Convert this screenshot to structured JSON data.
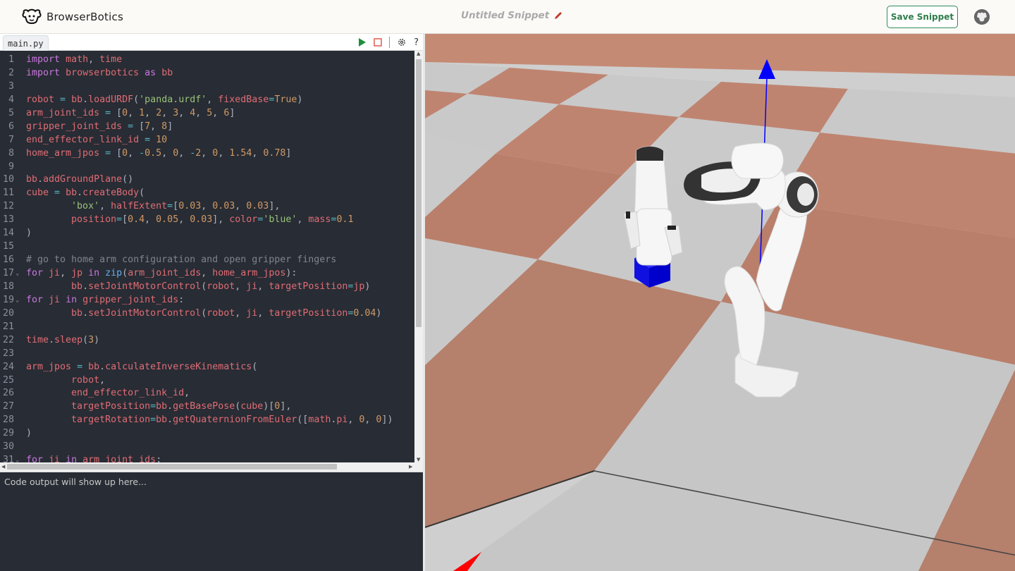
{
  "app": {
    "brand_name": "BrowserBotics",
    "snippet_title": "Untitled Snippet",
    "save_label": "Save Snippet"
  },
  "editor": {
    "file_tab": "main.py",
    "tools": {
      "run_icon": "play-icon",
      "stop_icon": "stop-icon",
      "settings_icon": "gear-icon",
      "help_label": "?"
    },
    "lines": [
      {
        "n": "1"
      },
      {
        "n": "2"
      },
      {
        "n": "3"
      },
      {
        "n": "4"
      },
      {
        "n": "5"
      },
      {
        "n": "6"
      },
      {
        "n": "7"
      },
      {
        "n": "8"
      },
      {
        "n": "9"
      },
      {
        "n": "10"
      },
      {
        "n": "11"
      },
      {
        "n": "12"
      },
      {
        "n": "13"
      },
      {
        "n": "14"
      },
      {
        "n": "15"
      },
      {
        "n": "16"
      },
      {
        "n": "17"
      },
      {
        "n": "18"
      },
      {
        "n": "19"
      },
      {
        "n": "20"
      },
      {
        "n": "21"
      },
      {
        "n": "22"
      },
      {
        "n": "23"
      },
      {
        "n": "24"
      },
      {
        "n": "25"
      },
      {
        "n": "26"
      },
      {
        "n": "27"
      },
      {
        "n": "28"
      },
      {
        "n": "29"
      },
      {
        "n": "30"
      },
      {
        "n": "31"
      }
    ],
    "code": [
      "import math, time",
      "import browserbotics as bb",
      "",
      "robot = bb.loadURDF('panda.urdf', fixedBase=True)",
      "arm_joint_ids = [0, 1, 2, 3, 4, 5, 6]",
      "gripper_joint_ids = [7, 8]",
      "end_effector_link_id = 10",
      "home_arm_jpos = [0, -0.5, 0, -2, 0, 1.54, 0.78]",
      "",
      "bb.addGroundPlane()",
      "cube = bb.createBody(",
      "        'box', halfExtent=[0.03, 0.03, 0.03],",
      "        position=[0.4, 0.05, 0.03], color='blue', mass=0.1",
      ")",
      "",
      "# go to home arm configuration and open gripper fingers",
      "for ji, jp in zip(arm_joint_ids, home_arm_jpos):",
      "        bb.setJointMotorControl(robot, ji, targetPosition=jp)",
      "for ji in gripper_joint_ids:",
      "        bb.setJointMotorControl(robot, ji, targetPosition=0.04)",
      "",
      "time.sleep(3)",
      "",
      "arm_jpos = bb.calculateInverseKinematics(",
      "        robot,",
      "        end_effector_link_id,",
      "        targetPosition=bb.getBasePose(cube)[0],",
      "        targetRotation=bb.getQuaternionFromEuler([math.pi, 0, 0])",
      ")",
      "",
      "for ji in arm_joint_ids:"
    ]
  },
  "output": {
    "placeholder": "Code output will show up here..."
  },
  "colors": {
    "accent_green": "#2e8b57",
    "editor_bg": "#282c34",
    "tile_brown": "#b5806c",
    "tile_gray": "#c8c8c8",
    "cube_blue": "#0000ff"
  }
}
